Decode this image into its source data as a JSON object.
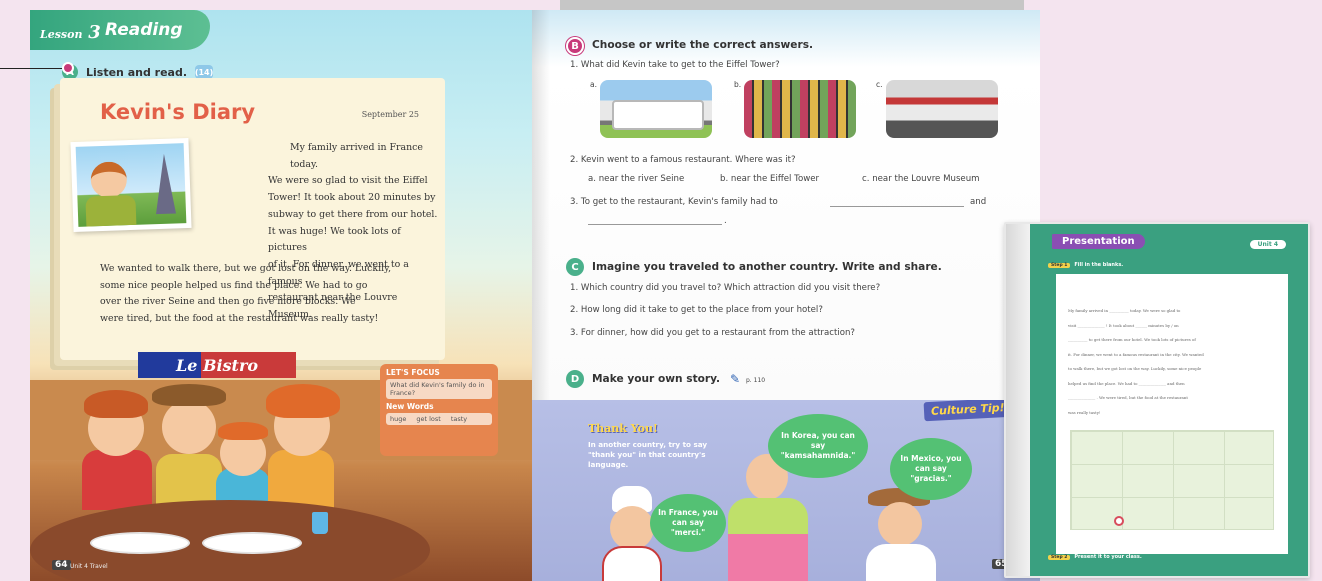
{
  "left_page": {
    "lesson_label": "Lesson",
    "lesson_number": "3",
    "lesson_title": "Reading",
    "instruction": "Listen and read.",
    "audio_track": "(14)",
    "diary_title": "Kevin's Diary",
    "diary_date": "September 25",
    "diary_lines": [
      "My family arrived in France today.",
      "We were so glad to visit the Eiffel",
      "Tower! It took about 20 minutes by",
      "subway to get there from our hotel.",
      "It was huge! We took lots of pictures",
      "of it. For dinner, we went to a famous",
      "restaurant near the Louvre Museum."
    ],
    "diary_lines_full": [
      "We wanted to walk there, but we got lost on the way. Luckily,",
      "some nice people helped us find the place. We had to go",
      "over the river Seine and then go five more blocks. We",
      "were tired, but the food at the restaurant was really tasty!"
    ],
    "sign_text": "Le Bistro",
    "focus_title": "LET'S FOCUS",
    "focus_question": "What did Kevin's family do in France?",
    "new_words_title": "New Words",
    "new_words": [
      "huge",
      "get lost",
      "tasty"
    ],
    "page_number": "64",
    "footer": "Unit 4 Travel"
  },
  "right_page": {
    "section_b": {
      "letter": "B",
      "heading": "Choose or write the correct answers.",
      "q1": "1.   What did Kevin take to get to the Eiffel Tower?",
      "q1_options": [
        "a.",
        "b.",
        "c."
      ],
      "q1_image_names": [
        "bus",
        "bicycles",
        "subway train"
      ],
      "q2": "2.   Kevin went to a famous restaurant. Where was it?",
      "q2_options": [
        "a. near the river Seine",
        "b. near the Eiffel Tower",
        "c. near the Louvre Museum"
      ],
      "q3_start": "3.   To get to the restaurant, Kevin's family had to",
      "q3_and": "and",
      "q3_end": "."
    },
    "section_c": {
      "letter": "C",
      "heading": "Imagine you traveled to another country. Write and share.",
      "questions": [
        "1.   Which country did you travel to? Which attraction did you visit there?",
        "2.   How long did it take to get to the place from your hotel?",
        "3.   For dinner, how did you get to a restaurant from the attraction?"
      ]
    },
    "section_d": {
      "letter": "D",
      "heading": "Make your own story.",
      "ref": "p. 110"
    },
    "culture": {
      "badge": "Culture Tip!",
      "title": "Thank You!",
      "body": "In another country, try to say \"thank you\" in that country's language.",
      "bubbles": [
        "In France, you can say \"merci.\"",
        "In Korea, you can say \"kamsahamnida.\"",
        "In Mexico, you can say \"gracias.\""
      ]
    },
    "page_number": "65"
  },
  "presentation": {
    "title": "Presentation",
    "unit": "Unit 4",
    "step1_tag": "Step 1",
    "step1": "Fill in the blanks.",
    "step2_tag": "Step 2",
    "step2": "Present it to your class.",
    "sheet_lines": [
      "My family arrived in __________ today. We were so glad to",
      "visit ______________ ! It took about ______ minutes by / on",
      "__________ to get there from our hotel. We took lots of pictures of",
      "it. For dinner, we went to a famous restaurant in the city. We wanted",
      "to walk there, but we got lost on the way. Luckily, some nice people",
      "helped us find the place. We had to ______________ and then",
      "______________ . We were tired, but the food at the restaurant",
      "was really tasty!"
    ]
  },
  "colors": {
    "accent_green": "#3aa080",
    "accent_pink": "#c83a7a",
    "title_red": "#e26048",
    "culture_blue": "#a7b0dc"
  }
}
